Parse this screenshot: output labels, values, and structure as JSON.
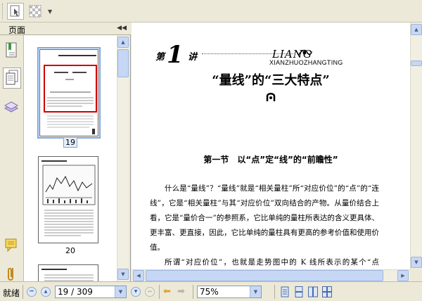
{
  "left_pane": {
    "title": "页面",
    "thumbnails": [
      {
        "page": "19",
        "selected": true
      },
      {
        "page": "20",
        "selected": false
      }
    ]
  },
  "document": {
    "chapter_di": "第",
    "chapter_num": "1",
    "chapter_jiang": "讲",
    "pinyin_top": "LIANG",
    "pinyin_bottom": "XIANZHUOZHANGTING",
    "lecture_title": "“量线”的“三大特点”",
    "section_title": "第一节　以“点”定“线”的“前瞻性”",
    "paragraphs": [
      "什么是“量线”？“量线”就是“相关量柱”所“对应价位”的“点”的“连线”，它是“相关量柱”与其“对应价位”双向结合的产物。从量价结合上看，它是“量价合一”的参照系，它比单纯的量柱所表达的含义更具体、更丰富、更直接，因此，它比单纯的量柱具有更高的参考价值和使用价值。",
      "所谓“对应价位”，也就是走势图中的 K 线所表示的某个“点位”或“价位”。K 线由开盘价、收盘价、最高价、最低价四个价位构成，而量线"
    ]
  },
  "status": {
    "ready": "就绪",
    "page_field": "19 / 309",
    "zoom": "75%"
  },
  "colors": {
    "selection_border": "#7aa6dc",
    "thumb_red_frame": "#cc0000",
    "scrollbar": "#c6d6f5"
  }
}
